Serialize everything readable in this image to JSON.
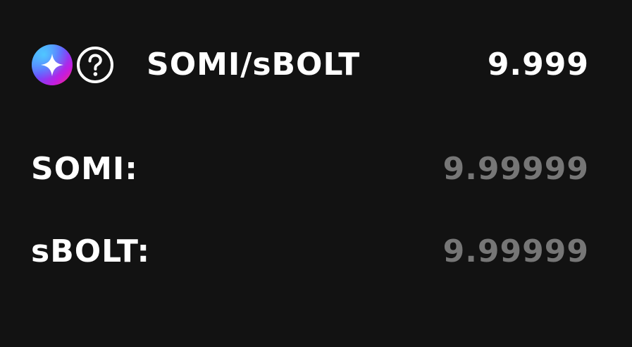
{
  "pair": {
    "name": "SOMI/sBOLT",
    "value": "9.999",
    "logo_icon": "somi-token-logo-icon",
    "info_icon": "question-circle-icon"
  },
  "balances": [
    {
      "label": "SOMI:",
      "value": "9.99999"
    },
    {
      "label": "sBOLT:",
      "value": "9.99999"
    }
  ],
  "colors": {
    "background": "#121212",
    "text_primary": "#ffffff",
    "text_muted": "#767676"
  }
}
